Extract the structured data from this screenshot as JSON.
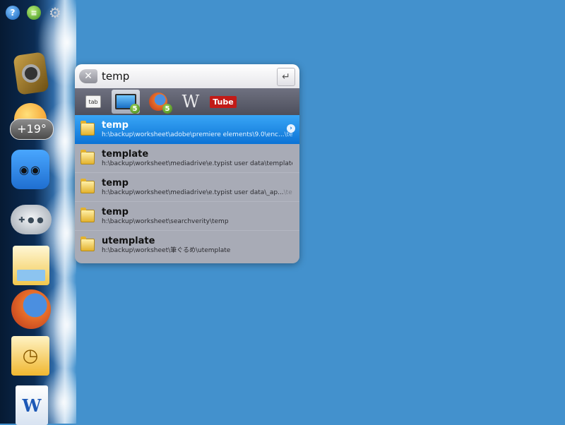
{
  "dock": {
    "top_icons": [
      "help-icon",
      "chat-icon",
      "gear-icon"
    ],
    "help_glyph": "?",
    "chat_glyph": "≡",
    "gear_glyph": "⚙",
    "weather_temp": "+19°"
  },
  "search": {
    "query": "temp",
    "clear_glyph": "✕",
    "enter_glyph": "↵"
  },
  "tabs": [
    {
      "name": "tab",
      "label": "tab",
      "badge": ""
    },
    {
      "name": "computer",
      "label": "",
      "badge": "5"
    },
    {
      "name": "firefox",
      "label": "",
      "badge": "5"
    },
    {
      "name": "wikipedia",
      "label": "W",
      "badge": ""
    },
    {
      "name": "youtube",
      "label": "Tube",
      "badge": ""
    }
  ],
  "results": [
    {
      "title": "temp",
      "path": "h:\\backup\\worksheet\\adobe\\premiere  elements\\9.0\\enc...",
      "path_fade": "\\temp",
      "selected": true
    },
    {
      "title": "template",
      "path": "h:\\backup\\worksheet\\mediadrive\\e.typist  user  data\\template",
      "path_fade": "",
      "selected": false
    },
    {
      "title": "temp",
      "path": "h:\\backup\\worksheet\\mediadrive\\e.typist  user  data\\_ap...",
      "path_fade": "\\temp",
      "selected": false
    },
    {
      "title": "temp",
      "path": "h:\\backup\\worksheet\\searchverity\\temp",
      "path_fade": "",
      "selected": false
    },
    {
      "title": "utemplate",
      "path": "h:\\backup\\worksheet\\筆ぐるめ\\utemplate",
      "path_fade": "",
      "selected": false
    }
  ],
  "more_glyph": "›",
  "colors": {
    "desktop": "#4391cd",
    "selection": "#0d74d6",
    "panel": "#a8abb6"
  }
}
